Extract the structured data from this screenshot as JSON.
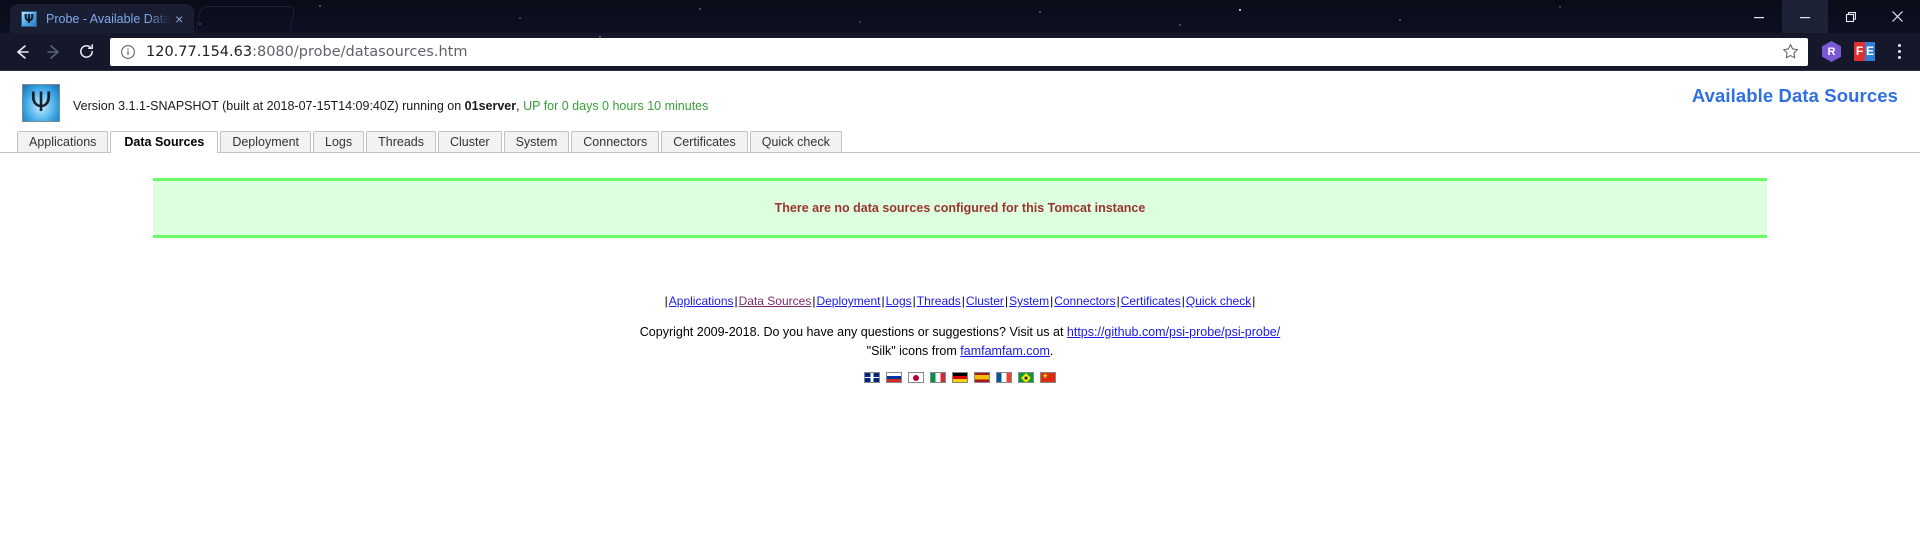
{
  "browser": {
    "tab": {
      "title": "Probe - Available Data",
      "favicon": "psi-icon",
      "close_label": "×"
    },
    "window_controls": {
      "minimize": "minimize-icon",
      "restore": "restore-icon",
      "maximize": "maximize-icon",
      "close": "close-icon"
    },
    "toolbar": {
      "back": "back-arrow-icon",
      "forward": "forward-arrow-icon",
      "reload": "reload-icon",
      "site_info": "info-circle-icon",
      "url_host": "120.77.154.63",
      "url_path": ":8080/probe/datasources.htm",
      "url_full": "120.77.154.63:8080/probe/datasources.htm",
      "bookmark": "star-icon",
      "extension_r": "R",
      "extension_f": "F",
      "extension_e": "E",
      "menu": "kebab-menu-icon"
    }
  },
  "page": {
    "logo_glyph": "Ψ",
    "version_prefix": "Version 3.1.1-SNAPSHOT (built at 2018-07-15T14:09:40Z) running on ",
    "server_name": "01server",
    "version_comma": ", ",
    "uptime": "UP for 0 days 0 hours 10 minutes",
    "title": "Available Data Sources",
    "tabs": [
      {
        "label": "Applications",
        "active": false
      },
      {
        "label": "Data Sources",
        "active": true
      },
      {
        "label": "Deployment",
        "active": false
      },
      {
        "label": "Logs",
        "active": false
      },
      {
        "label": "Threads",
        "active": false
      },
      {
        "label": "Cluster",
        "active": false
      },
      {
        "label": "System",
        "active": false
      },
      {
        "label": "Connectors",
        "active": false
      },
      {
        "label": "Certificates",
        "active": false
      },
      {
        "label": "Quick check",
        "active": false
      }
    ],
    "notice": {
      "text": "There are no data sources configured for this Tomcat instance",
      "bg_color": "#ddffdd",
      "border_color": "#66ff66",
      "text_color": "#993333"
    },
    "footer": {
      "separator": "|",
      "links": [
        {
          "label": "Applications",
          "visited": false
        },
        {
          "label": "Data Sources",
          "visited": true
        },
        {
          "label": "Deployment",
          "visited": false
        },
        {
          "label": "Logs",
          "visited": false
        },
        {
          "label": "Threads",
          "visited": false
        },
        {
          "label": "Cluster",
          "visited": false
        },
        {
          "label": "System",
          "visited": false
        },
        {
          "label": "Connectors",
          "visited": false
        },
        {
          "label": "Certificates",
          "visited": false
        },
        {
          "label": "Quick check",
          "visited": false
        }
      ],
      "copyright_text": "Copyright 2009-2018. Do you have any questions or suggestions? Visit us at ",
      "project_url": "https://github.com/psi-probe/psi-probe/",
      "silk_prefix": "\"Silk\" icons from ",
      "silk_link": "famfamfam.com",
      "silk_suffix": ".",
      "languages": [
        {
          "name": "english",
          "code": "uk"
        },
        {
          "name": "russian",
          "code": "ru"
        },
        {
          "name": "japanese",
          "code": "jp"
        },
        {
          "name": "italian",
          "code": "it"
        },
        {
          "name": "german",
          "code": "de"
        },
        {
          "name": "spanish",
          "code": "es"
        },
        {
          "name": "french",
          "code": "fr"
        },
        {
          "name": "portuguese-brazil",
          "code": "br"
        },
        {
          "name": "chinese",
          "code": "cn"
        }
      ]
    }
  }
}
